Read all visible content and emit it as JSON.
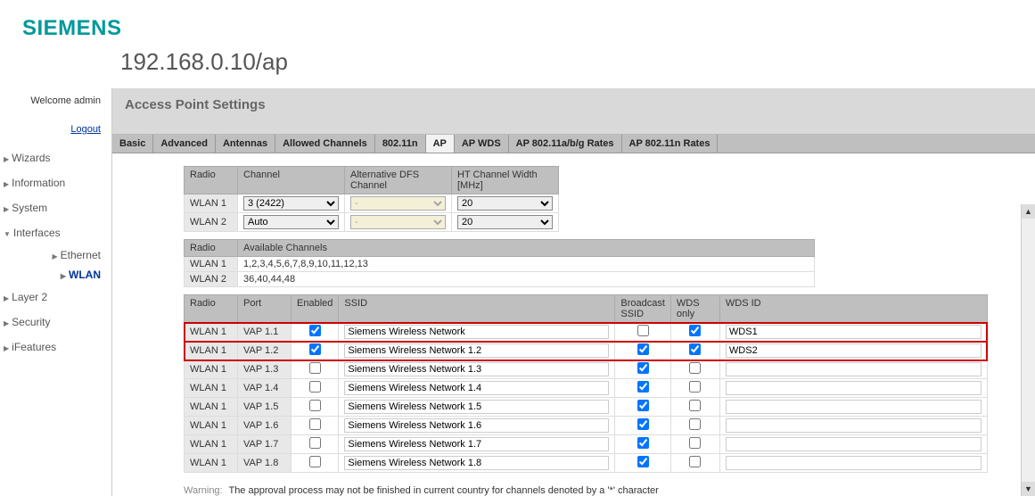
{
  "brand": "SIEMENS",
  "url": "192.168.0.10/ap",
  "sidebar": {
    "welcome": "Welcome admin",
    "logout": "Logout",
    "items": [
      {
        "label": "Wizards",
        "type": "top"
      },
      {
        "label": "Information",
        "type": "top"
      },
      {
        "label": "System",
        "type": "top"
      },
      {
        "label": "Interfaces",
        "type": "expanded",
        "children": [
          {
            "label": "Ethernet",
            "active": false
          },
          {
            "label": "WLAN",
            "active": true
          }
        ]
      },
      {
        "label": "Layer 2",
        "type": "top"
      },
      {
        "label": "Security",
        "type": "top"
      },
      {
        "label": "iFeatures",
        "type": "top"
      }
    ]
  },
  "page_title": "Access Point Settings",
  "tabs": [
    "Basic",
    "Advanced",
    "Antennas",
    "Allowed Channels",
    "802.11n",
    "AP",
    "AP WDS",
    "AP 802.11a/b/g Rates",
    "AP 802.11n Rates"
  ],
  "active_tab": "AP",
  "channel_table": {
    "headers": [
      "Radio",
      "Channel",
      "Alternative DFS Channel",
      "HT Channel Width [MHz]"
    ],
    "rows": [
      {
        "radio": "WLAN 1",
        "channel": "3 (2422)",
        "dfs": "-",
        "dfs_disabled": true,
        "ht": "20"
      },
      {
        "radio": "WLAN 2",
        "channel": "Auto",
        "dfs": "-",
        "dfs_disabled": true,
        "ht": "20"
      }
    ]
  },
  "avail_table": {
    "headers": [
      "Radio",
      "Available Channels"
    ],
    "rows": [
      {
        "radio": "WLAN 1",
        "channels": "1,2,3,4,5,6,7,8,9,10,11,12,13"
      },
      {
        "radio": "WLAN 2",
        "channels": "36,40,44,48"
      }
    ]
  },
  "vap_table": {
    "headers": [
      "Radio",
      "Port",
      "Enabled",
      "SSID",
      "Broadcast SSID",
      "WDS only",
      "WDS ID"
    ],
    "rows": [
      {
        "radio": "WLAN 1",
        "port": "VAP 1.1",
        "enabled": true,
        "ssid": "Siemens Wireless Network",
        "broadcast": false,
        "wds": true,
        "wdsid": "WDS1",
        "hl": true
      },
      {
        "radio": "WLAN 1",
        "port": "VAP 1.2",
        "enabled": true,
        "ssid": "Siemens Wireless Network 1.2",
        "broadcast": true,
        "wds": true,
        "wdsid": "WDS2",
        "hl": true
      },
      {
        "radio": "WLAN 1",
        "port": "VAP 1.3",
        "enabled": false,
        "ssid": "Siemens Wireless Network 1.3",
        "broadcast": true,
        "wds": false,
        "wdsid": "",
        "hl": false
      },
      {
        "radio": "WLAN 1",
        "port": "VAP 1.4",
        "enabled": false,
        "ssid": "Siemens Wireless Network 1.4",
        "broadcast": true,
        "wds": false,
        "wdsid": "",
        "hl": false
      },
      {
        "radio": "WLAN 1",
        "port": "VAP 1.5",
        "enabled": false,
        "ssid": "Siemens Wireless Network 1.5",
        "broadcast": true,
        "wds": false,
        "wdsid": "",
        "hl": false
      },
      {
        "radio": "WLAN 1",
        "port": "VAP 1.6",
        "enabled": false,
        "ssid": "Siemens Wireless Network 1.6",
        "broadcast": true,
        "wds": false,
        "wdsid": "",
        "hl": false
      },
      {
        "radio": "WLAN 1",
        "port": "VAP 1.7",
        "enabled": false,
        "ssid": "Siemens Wireless Network 1.7",
        "broadcast": true,
        "wds": false,
        "wdsid": "",
        "hl": false
      },
      {
        "radio": "WLAN 1",
        "port": "VAP 1.8",
        "enabled": false,
        "ssid": "Siemens Wireless Network 1.8",
        "broadcast": true,
        "wds": false,
        "wdsid": "",
        "hl": false
      }
    ]
  },
  "warning_label": "Warning:",
  "warning_text": "The approval process may not be finished in current country for channels denoted by a '*' character"
}
